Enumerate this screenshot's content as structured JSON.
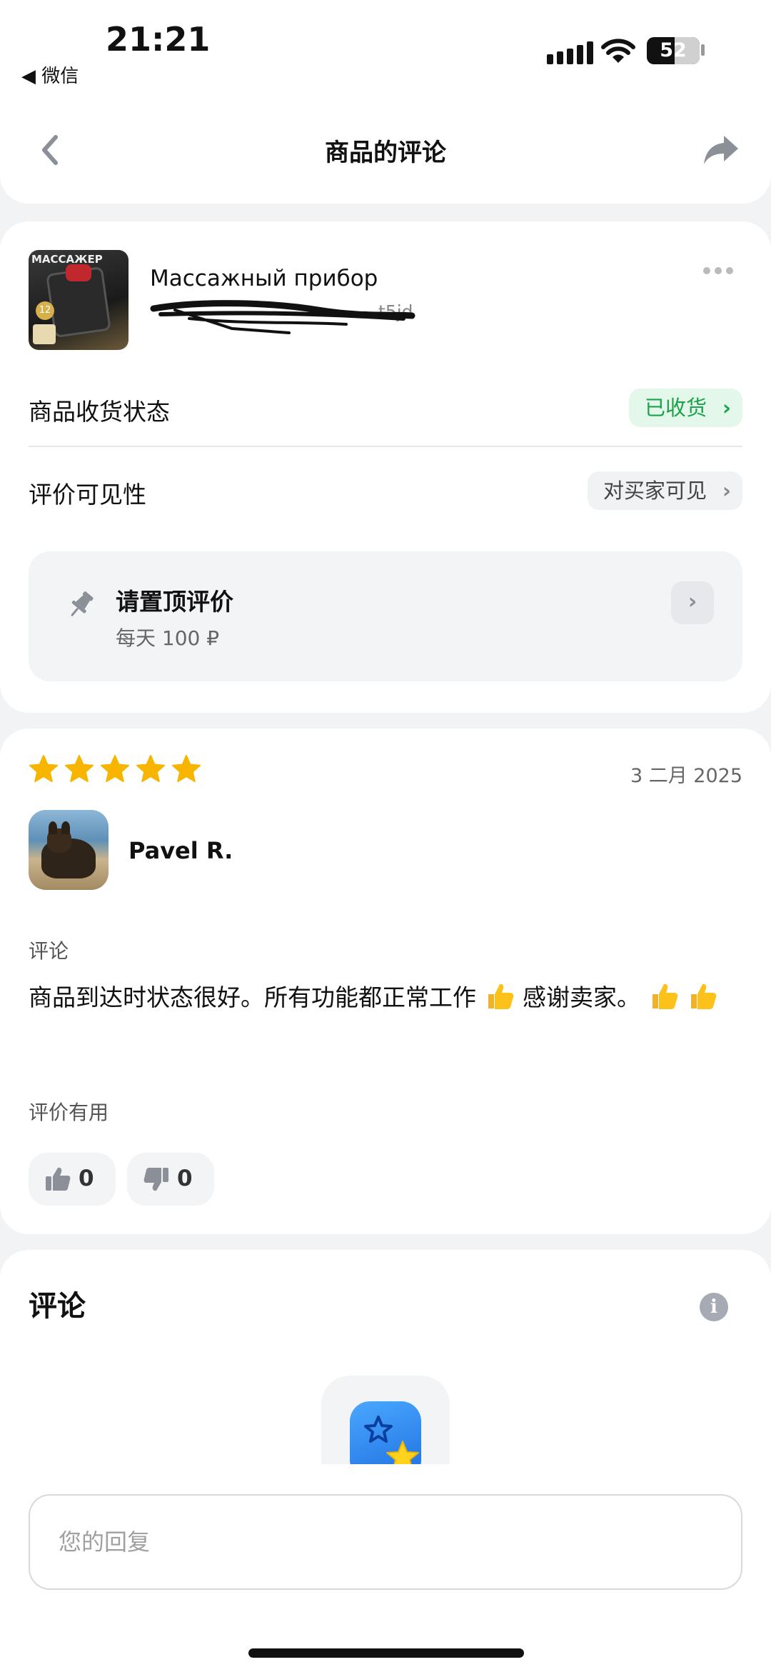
{
  "status_bar": {
    "time": "21:21",
    "back_app": "◀ 微信",
    "battery": "52"
  },
  "header": {
    "title": "商品的评论",
    "back_icon": "chevron-left-icon",
    "share_icon": "share-arrow-icon"
  },
  "product": {
    "name": "Массажный прибор",
    "id_fragment": "t5jd",
    "delivery_status_label": "商品收货状态",
    "delivery_status_value": "已收货",
    "visibility_label": "评价可见性",
    "visibility_value": "对买家可见",
    "pin": {
      "title": "请置顶评价",
      "subtitle": "每天 100 ₽"
    }
  },
  "review": {
    "rating": 5,
    "date": "3 二月 2025",
    "author": "Pavel R.",
    "comment_label": "评论",
    "text_part1": "商品到达时状态很好。所有功能都正常工作",
    "text_part2": "感谢卖家。",
    "helpful_label": "评价有用",
    "likes": "0",
    "dislikes": "0"
  },
  "comments": {
    "title": "评论",
    "reply_placeholder": "您的回复"
  },
  "colors": {
    "accent_green": "#1aa34a",
    "star_yellow": "#f7b500",
    "background": "#f2f3f5"
  }
}
